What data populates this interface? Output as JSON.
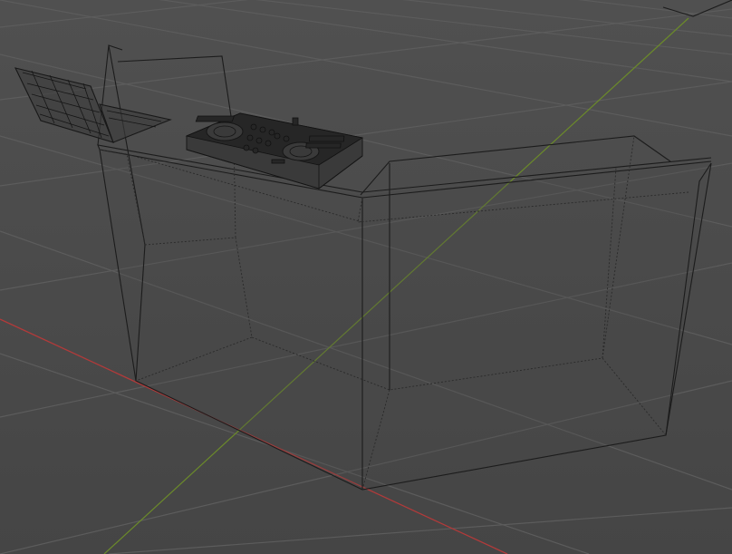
{
  "viewport": {
    "background": "#4a4a4a",
    "grid_color": "#5c5c5c",
    "x_axis_color": "#b23a3a",
    "y_axis_color": "#6b8a2a",
    "wire_color": "#1c1c1c"
  },
  "scene": {
    "objects": [
      {
        "name": "dj-booth",
        "display": "wireframe"
      },
      {
        "name": "dj-controller",
        "display": "wireframe"
      },
      {
        "name": "laptop",
        "display": "wireframe"
      }
    ]
  }
}
